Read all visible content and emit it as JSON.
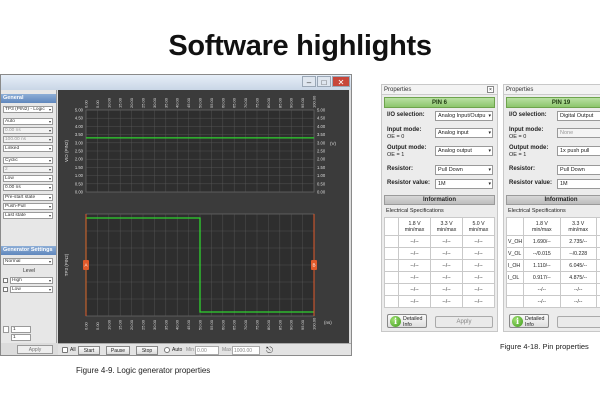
{
  "slide": {
    "title": "Software highlights"
  },
  "logic_generator": {
    "caption": "Figure 4-9. Logic generator properties",
    "left_panel": {
      "section_general": "General",
      "pin_select": "TP3 (PIN2) - Logic",
      "fields": [
        "Auto",
        "0.00 ns",
        "100.00 ns",
        "Linked",
        "Cyclic",
        "2",
        "Low",
        "0.00 ns",
        "Pre-start state",
        "Push-Pull",
        "Last state"
      ],
      "section_generator": "Generator Settings",
      "mode": "Normal",
      "level_label": "Level",
      "levels": [
        "High",
        "Low"
      ],
      "spin_values": [
        "1",
        "1"
      ],
      "apply_label": "Apply"
    },
    "plot": {
      "top_y_ticks": [
        "5.00",
        "4.50",
        "4.00",
        "3.50",
        "3.00",
        "2.50",
        "2.00",
        "1.50",
        "1.00",
        "0.50",
        "0.00"
      ],
      "top_y_label": "VIO (PIN2)",
      "right_unit": "(V)",
      "top_x_ticks": [
        "0.00",
        "5.00",
        "10.00",
        "15.00",
        "20.00",
        "25.00",
        "30.00",
        "35.00",
        "40.00",
        "45.00",
        "50.00",
        "55.00",
        "60.00",
        "65.00",
        "70.00",
        "75.00",
        "80.00",
        "85.00",
        "90.00",
        "95.00",
        "100.00"
      ],
      "bottom_x_ticks": [
        "0.00",
        "5.00",
        "10.00",
        "15.00",
        "20.00",
        "25.00",
        "30.00",
        "35.00",
        "40.00",
        "45.00",
        "50.00",
        "55.00",
        "60.00",
        "65.00",
        "70.00",
        "75.00",
        "80.00",
        "85.00",
        "90.00",
        "95.00",
        "100.00"
      ],
      "bottom_unit": "(ns)",
      "bottom_y_label": "TP3 (PIN2)",
      "marker_a": "A",
      "marker_b": "B",
      "colors": {
        "bg": "#3b3b3b",
        "grid": "#5a5a5a",
        "trace": "#2fd32f",
        "marker": "#e05a2b"
      }
    },
    "chart_data": {
      "type": "line",
      "title": "",
      "ylabel": "VIO (PIN2)",
      "ylim": [
        0,
        5
      ],
      "xlim": [
        0,
        100
      ],
      "x": [
        0,
        100
      ],
      "series": [
        {
          "values": [
            3.3,
            3.3
          ]
        }
      ]
    },
    "bottom_bar": {
      "all_label": "All",
      "start_label": "Start",
      "pause_label": "Pause",
      "stop_label": "Stop",
      "auto_label": "Auto",
      "min_label": "Min",
      "min_value": "0.00",
      "max_label": "Max",
      "max_value": "1000.00"
    }
  },
  "pin6": {
    "header": "Properties",
    "close_glyph": "×",
    "pin_title": "PIN 6",
    "io_selection_label": "I/O selection:",
    "io_selection_value": "Analog Input/Outpu",
    "input_mode_label": "Input mode:",
    "input_mode_sub": "OE = 0",
    "input_mode_value": "Analog input",
    "output_mode_label": "Output mode:",
    "output_mode_sub": "OE = 1",
    "output_mode_value": "Analog output",
    "resistor_label": "Resistor:",
    "resistor_value": "Pull Down",
    "resistor_val_label": "Resistor value:",
    "resistor_val_value": "1M",
    "information_label": "Information",
    "elec_label": "Electrical Specifications",
    "columns": [
      "1.8 V\nmin/max",
      "3.3 V\nmin/max",
      "5.0 V\nmin/max"
    ],
    "rows": [
      [
        "--/--",
        "--/--",
        "--/--"
      ],
      [
        "--/--",
        "--/--",
        "--/--"
      ],
      [
        "--/--",
        "--/--",
        "--/--"
      ],
      [
        "--/--",
        "--/--",
        "--/--"
      ],
      [
        "--/--",
        "--/--",
        "--/--"
      ],
      [
        "--/--",
        "--/--",
        "--/--"
      ]
    ],
    "detailed_info_label": "Detailed Info",
    "apply_label": "Apply"
  },
  "pin19": {
    "header": "Properties",
    "pin_title": "PIN 19",
    "io_selection_label": "I/O selection:",
    "io_selection_value": "Digital Output",
    "input_mode_label": "Input mode:",
    "input_mode_sub": "OE = 0",
    "input_mode_value": "None",
    "output_mode_label": "Output mode:",
    "output_mode_sub": "OE = 1",
    "output_mode_value": "1x push pull",
    "resistor_label": "Resistor:",
    "resistor_value": "Pull Down",
    "resistor_val_label": "Resistor value:",
    "resistor_val_value": "1M",
    "information_label": "Information",
    "elec_label": "Electrical Specifications",
    "columns": [
      "1.8 V\nmin/max",
      "3.3 V\nmin/max",
      "5"
    ],
    "rows": [
      [
        "V_OH",
        "1.690/--",
        "2.735/--",
        "4.19"
      ],
      [
        "V_OL",
        "--/0.015",
        "--/0.228",
        "--/0."
      ],
      [
        "I_OH",
        "1.110/--",
        "6.045/--",
        "22.0"
      ],
      [
        "I_OL",
        "0.917/--",
        "4.875/--",
        "7.21"
      ],
      [
        "",
        "--/--",
        "--/--",
        "--/"
      ],
      [
        "",
        "--/--",
        "--/--",
        "--/"
      ]
    ],
    "detailed_info_label": "Detailed Info",
    "caption": "Figure 4-18. Pin properties"
  }
}
